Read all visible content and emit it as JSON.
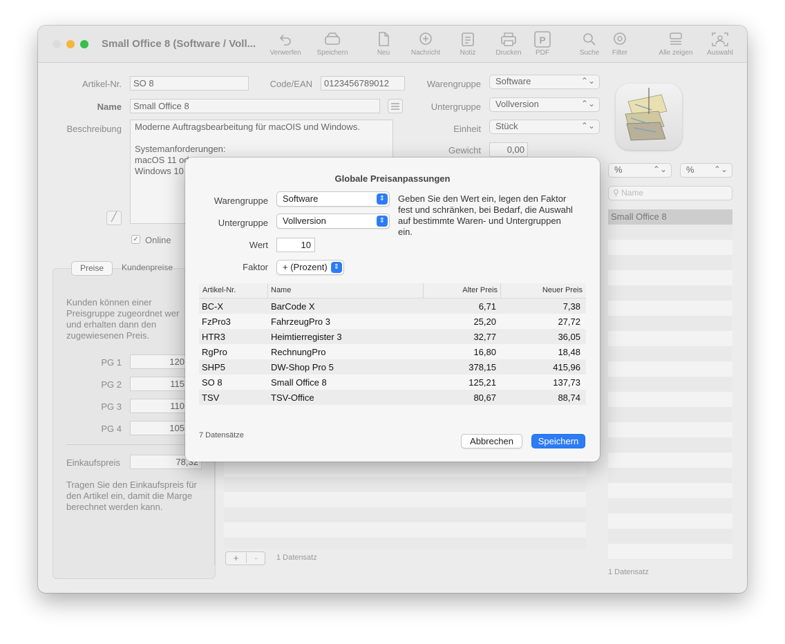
{
  "window": {
    "title": "Small Office 8 (Software / Voll...",
    "toolbar": [
      {
        "label": "Verwerfen",
        "icon": "undo-icon"
      },
      {
        "label": "Speichern",
        "icon": "drive-icon"
      },
      {
        "label": "Neu",
        "icon": "new-document-icon"
      },
      {
        "label": "Nachricht",
        "icon": "message-icon"
      },
      {
        "label": "Notiz",
        "icon": "note-icon"
      },
      {
        "label": "Drucken",
        "icon": "printer-icon"
      },
      {
        "label": "PDF",
        "icon": "pdf-icon"
      },
      {
        "label": "Suche",
        "icon": "search-icon"
      },
      {
        "label": "Filter",
        "icon": "filter-icon"
      },
      {
        "label": "Alle zeigen",
        "icon": "list-icon"
      },
      {
        "label": "Auswahl",
        "icon": "selection-icon"
      }
    ]
  },
  "form": {
    "artikel_label": "Artikel-Nr.",
    "artikel_value": "SO 8",
    "code_label": "Code/EAN",
    "code_value": "0123456789012",
    "warengruppe_label": "Warengruppe",
    "warengruppe_value": "Software",
    "untergruppe_label": "Untergruppe",
    "untergruppe_value": "Vollversion",
    "einheit_label": "Einheit",
    "einheit_value": "Stück",
    "gewicht_label": "Gewicht",
    "gewicht_value": "0,00",
    "name_label": "Name",
    "name_value": "Small Office 8",
    "beschreibung_label": "Beschreibung",
    "beschreibung_lines": [
      "Moderne Auftragsbearbeitung für macOIS und Windows.",
      "",
      "Systemanforderungen:",
      "macOS 11 od",
      "Windows 10"
    ],
    "online_label": "Online",
    "online_checked": true
  },
  "tabs": [
    "Preise",
    "Kundenpreise"
  ],
  "preise": {
    "info_lines": [
      "Kunden können einer",
      "Preisgruppe zugeordnet wer",
      "und erhalten dann den",
      "zugewiesenen Preis."
    ],
    "pg": [
      {
        "label": "PG 1",
        "value": "120"
      },
      {
        "label": "PG 2",
        "value": "115"
      },
      {
        "label": "PG 3",
        "value": "110"
      },
      {
        "label": "PG 4",
        "value": "105"
      }
    ],
    "einkauf_label": "Einkaufspreis",
    "einkauf_value": "78,32",
    "einkauf_info_lines": [
      "Tragen Sie den Einkaufspreis für",
      "den Artikel ein, damit die Marge",
      "berechnet werden kann."
    ],
    "add_label": "+",
    "remove_label": "-",
    "count": "1 Datensatz"
  },
  "right_panel": {
    "popup1": "%",
    "popup2": "%",
    "search_placeholder": "Name",
    "selected_item": "Small Office 8",
    "count": "1 Datensatz"
  },
  "dialog": {
    "title": "Globale Preisanpassungen",
    "warengruppe_label": "Warengruppe",
    "warengruppe_value": "Software",
    "untergruppe_label": "Untergruppe",
    "untergruppe_value": "Vollversion",
    "wert_label": "Wert",
    "wert_value": "10",
    "faktor_label": "Faktor",
    "faktor_value": "+ (Prozent)",
    "help_lines": [
      "Geben Sie den Wert ein, legen den Faktor",
      "fest und schränken, bei Bedarf, die Auswahl",
      "auf bestimmte Waren- und Untergruppen",
      "ein."
    ],
    "columns": [
      "Artikel-Nr.",
      "Name",
      "Alter Preis",
      "Neuer Preis"
    ],
    "rows": [
      [
        "BC-X",
        "BarCode X",
        "6,71",
        "7,38"
      ],
      [
        "FzPro3",
        "FahrzeugPro 3",
        "25,20",
        "27,72"
      ],
      [
        "HTR3",
        "Heimtierregister 3",
        "32,77",
        "36,05"
      ],
      [
        "RgPro",
        "RechnungPro",
        "16,80",
        "18,48"
      ],
      [
        "SHP5",
        "DW-Shop Pro 5",
        "378,15",
        "415,96"
      ],
      [
        "SO 8",
        "Small Office 8",
        "125,21",
        "137,73"
      ],
      [
        "TSV",
        "TSV-Office",
        "80,67",
        "88,74"
      ]
    ],
    "count": "7 Datensätze",
    "cancel_label": "Abbrechen",
    "save_label": "Speichern",
    "accent": "#2d7cf6"
  }
}
